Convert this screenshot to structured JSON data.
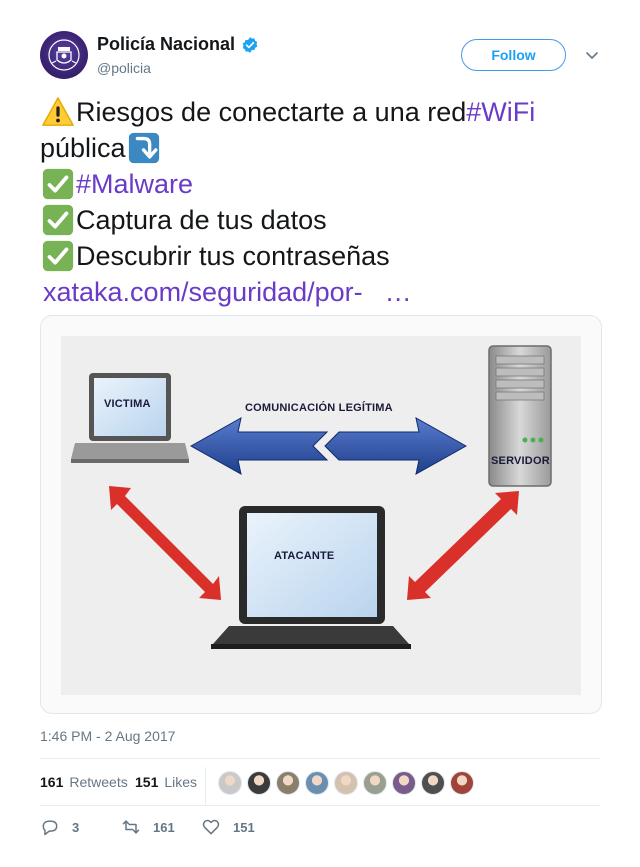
{
  "user": {
    "display_name": "Policía Nacional",
    "handle": "@policia",
    "verified": true,
    "avatar_icon": "police-badge-icon"
  },
  "follow_label": "Follow",
  "tweet": {
    "line1_text": "Riesgos de conectarte a una red ",
    "line1_hashtag": "#WiFi",
    "line2_text": "pública",
    "line3_hashtag": "#Malware",
    "line4_text": "Captura de tus datos",
    "line5_text": "Descubrir tus contraseñas",
    "link": "xataka.com/seguridad/por-",
    "ellipsis": "…"
  },
  "media": {
    "label_victim": "VICTIMA",
    "label_comm": "COMUNICACIÓN LEGÍTIMA",
    "label_server": "SERVIDOR",
    "label_attacker": "ATACANTE"
  },
  "timestamp": "1:46 PM - 2 Aug 2017",
  "stats": {
    "retweets_count": "161",
    "retweets_label": "Retweets",
    "likes_count": "151",
    "likes_label": "Likes"
  },
  "likers": [
    "#c9c9c9",
    "#3b3b3b",
    "#8a7f6a",
    "#6a8fb0",
    "#d4c2b0",
    "#9aa08f",
    "#7a5c8c",
    "#4f4f4f",
    "#a0443a"
  ],
  "actions": {
    "replies": "3",
    "retweets": "161",
    "likes": "151"
  },
  "colors": {
    "hashtag": "#6a3bc6",
    "follow": "#1da1f2",
    "verified": "#1da1f2",
    "arrow_blue": "#2a4a9a",
    "arrow_red": "#d9302a"
  }
}
